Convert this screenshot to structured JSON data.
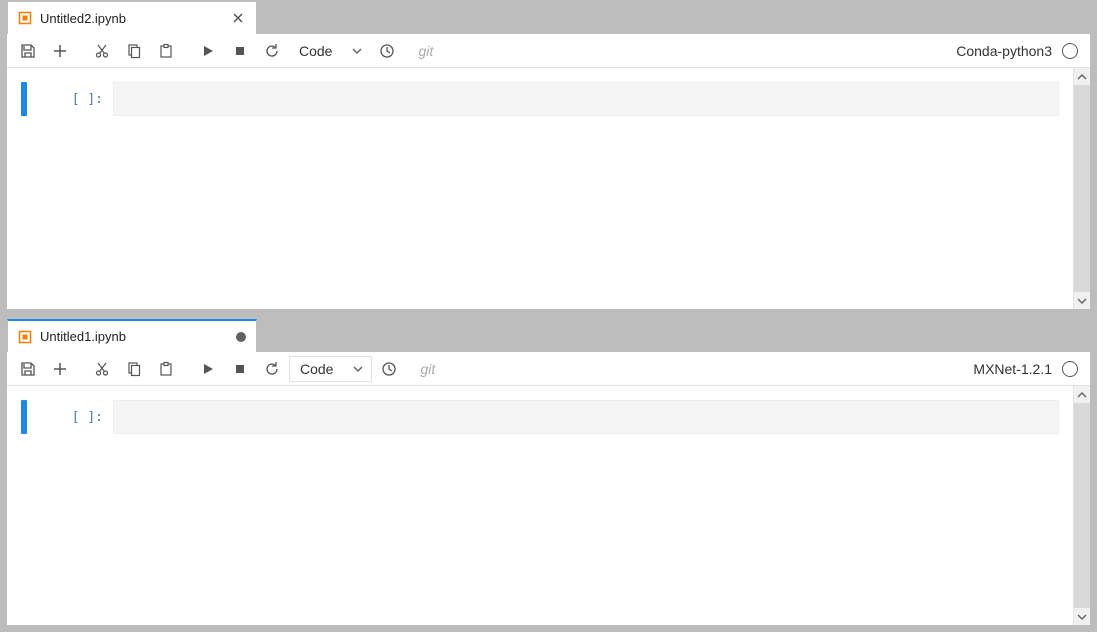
{
  "panes": [
    {
      "tab": {
        "title": "Untitled2.ipynb",
        "dirty": false
      },
      "toolbar": {
        "cell_type": "Code",
        "git_label": "git",
        "kernel": "Conda-python3",
        "cell_type_boxed": false
      },
      "cell": {
        "prompt": "[ ]:"
      }
    },
    {
      "tab": {
        "title": "Untitled1.ipynb",
        "dirty": true
      },
      "toolbar": {
        "cell_type": "Code",
        "git_label": "git",
        "kernel": "MXNet-1.2.1",
        "cell_type_boxed": true
      },
      "cell": {
        "prompt": "[ ]:"
      }
    }
  ]
}
